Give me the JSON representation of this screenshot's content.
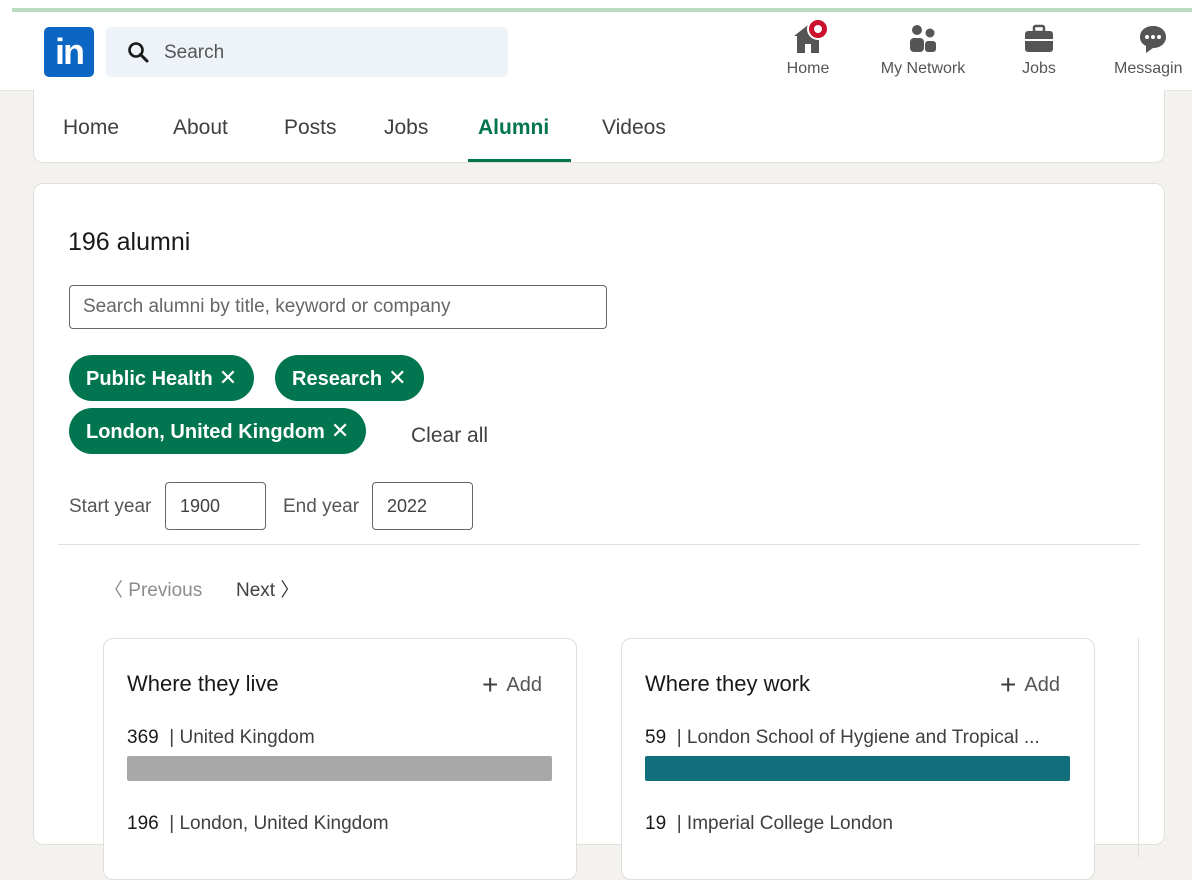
{
  "nav": {
    "logo_text": "in",
    "search_placeholder": "Search",
    "items": [
      {
        "label": "Home",
        "icon": "home-icon"
      },
      {
        "label": "My Network",
        "icon": "network-icon"
      },
      {
        "label": "Jobs",
        "icon": "briefcase-icon"
      },
      {
        "label": "Messagin",
        "icon": "messaging-icon"
      }
    ]
  },
  "tabs": [
    {
      "label": "Home"
    },
    {
      "label": "About"
    },
    {
      "label": "Posts"
    },
    {
      "label": "Jobs"
    },
    {
      "label": "Alumni",
      "active": true
    },
    {
      "label": "Videos"
    }
  ],
  "alumni": {
    "count_label": "196 alumni",
    "search_placeholder": "Search alumni by title, keyword or company",
    "filters": [
      "Public Health",
      "Research",
      "London, United Kingdom"
    ],
    "clear_all": "Clear all",
    "start_year_label": "Start year",
    "start_year_value": "1900",
    "end_year_label": "End year",
    "end_year_value": "2022",
    "previous": "Previous",
    "next": "Next"
  },
  "insights": [
    {
      "title": "Where they live",
      "add_label": "Add",
      "rows": [
        {
          "count": "369",
          "label": "United Kingdom",
          "bar_fraction": 1.0,
          "bar_color": "#a8a8a8"
        },
        {
          "count": "196",
          "label": "London, United Kingdom"
        }
      ]
    },
    {
      "title": "Where they work",
      "add_label": "Add",
      "rows": [
        {
          "count": "59",
          "label": "London School of Hygiene and Tropical ...",
          "bar_fraction": 1.0,
          "bar_color": "#136e7c"
        },
        {
          "count": "19",
          "label": "Imperial College London"
        }
      ]
    }
  ],
  "colors": {
    "brand": "#0a66c2",
    "accent_green": "#01754f",
    "badge": "#cb112d"
  }
}
